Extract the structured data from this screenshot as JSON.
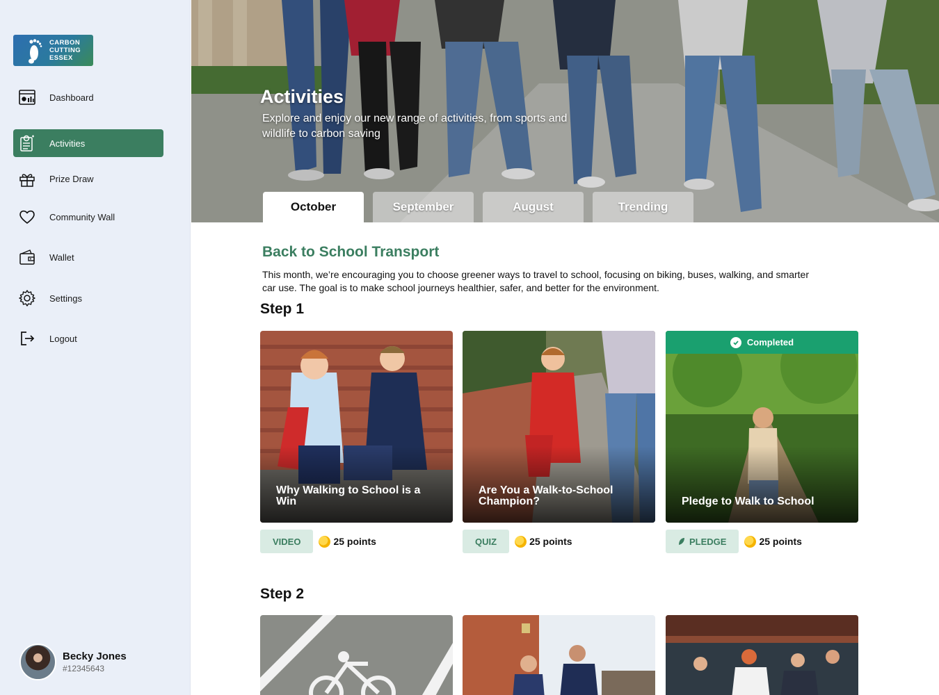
{
  "brand": {
    "logo_text": [
      "CARBON",
      "CUTTING",
      "ESSEX"
    ]
  },
  "sidebar": {
    "items": [
      {
        "label": "Dashboard",
        "icon": "dashboard-icon",
        "active": false
      },
      {
        "label": "Activities",
        "icon": "activities-icon",
        "active": true
      },
      {
        "label": "Prize Draw",
        "icon": "gift-box-icon",
        "active": false
      },
      {
        "label": "Community Wall",
        "icon": "heart-icon",
        "active": false
      },
      {
        "label": "Wallet",
        "icon": "wallet-icon",
        "active": false
      },
      {
        "label": "Settings",
        "icon": "gear-icon",
        "active": false
      },
      {
        "label": "Logout",
        "icon": "logout-icon",
        "active": false
      }
    ]
  },
  "user": {
    "name": "Becky Jones",
    "id": "#12345643"
  },
  "hero": {
    "title": "Activities",
    "subtitle": "Explore and enjoy our new range of activities, from sports and wildlife to carbon saving"
  },
  "tabs": [
    {
      "label": "October",
      "active": true
    },
    {
      "label": "September",
      "active": false
    },
    {
      "label": "August",
      "active": false
    },
    {
      "label": "Trending",
      "active": false
    }
  ],
  "section": {
    "title": "Back to School Transport",
    "description": "This month, we’re encouraging you to choose greener ways to travel to school, focusing on biking, buses, walking, and smarter car use. The goal is to make school journeys healthier, safer, and better for the environment."
  },
  "steps": [
    {
      "label": "Step 1",
      "cards": [
        {
          "title": "Why Walking to School is a Win",
          "type": "VIDEO",
          "points": "25 points",
          "completed": false
        },
        {
          "title": "Are You a Walk-to-School Champion?",
          "type": "QUIZ",
          "points": "25 points",
          "completed": false
        },
        {
          "title": "Pledge to Walk to School",
          "type": "PLEDGE",
          "points": "25 points",
          "completed": true,
          "status": "Completed"
        }
      ]
    },
    {
      "label": "Step 2"
    }
  ],
  "colors": {
    "accent": "#3b7e60",
    "completed": "#1aa06f",
    "sidebar_bg": "#eaeff8",
    "badge_bg": "#d9ebe3"
  }
}
